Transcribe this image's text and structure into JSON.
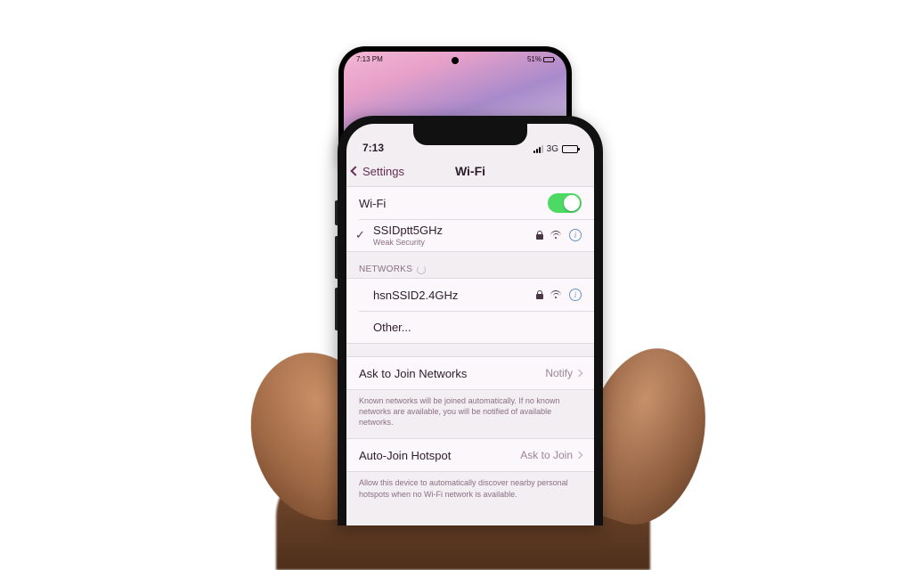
{
  "samsung_status": {
    "time": "7:13 PM",
    "battery": "51%"
  },
  "iphone_status": {
    "time": "7:13",
    "carrier": "3G"
  },
  "nav": {
    "back": "Settings",
    "title": "Wi-Fi"
  },
  "wifi_row": {
    "label": "Wi-Fi",
    "on": true
  },
  "connected": {
    "ssid": "SSIDptt5GHz",
    "sub": "Weak Security"
  },
  "networks_header": "NETWORKS",
  "networks": [
    {
      "ssid": "hsnSSID2.4GHz"
    }
  ],
  "other_label": "Other...",
  "ask": {
    "label": "Ask to Join Networks",
    "value": "Notify",
    "footer": "Known networks will be joined automatically. If no known networks are available, you will be notified of available networks."
  },
  "autohs": {
    "label": "Auto-Join Hotspot",
    "value": "Ask to Join",
    "footer": "Allow this device to automatically discover nearby personal hotspots when no Wi-Fi network is available."
  }
}
